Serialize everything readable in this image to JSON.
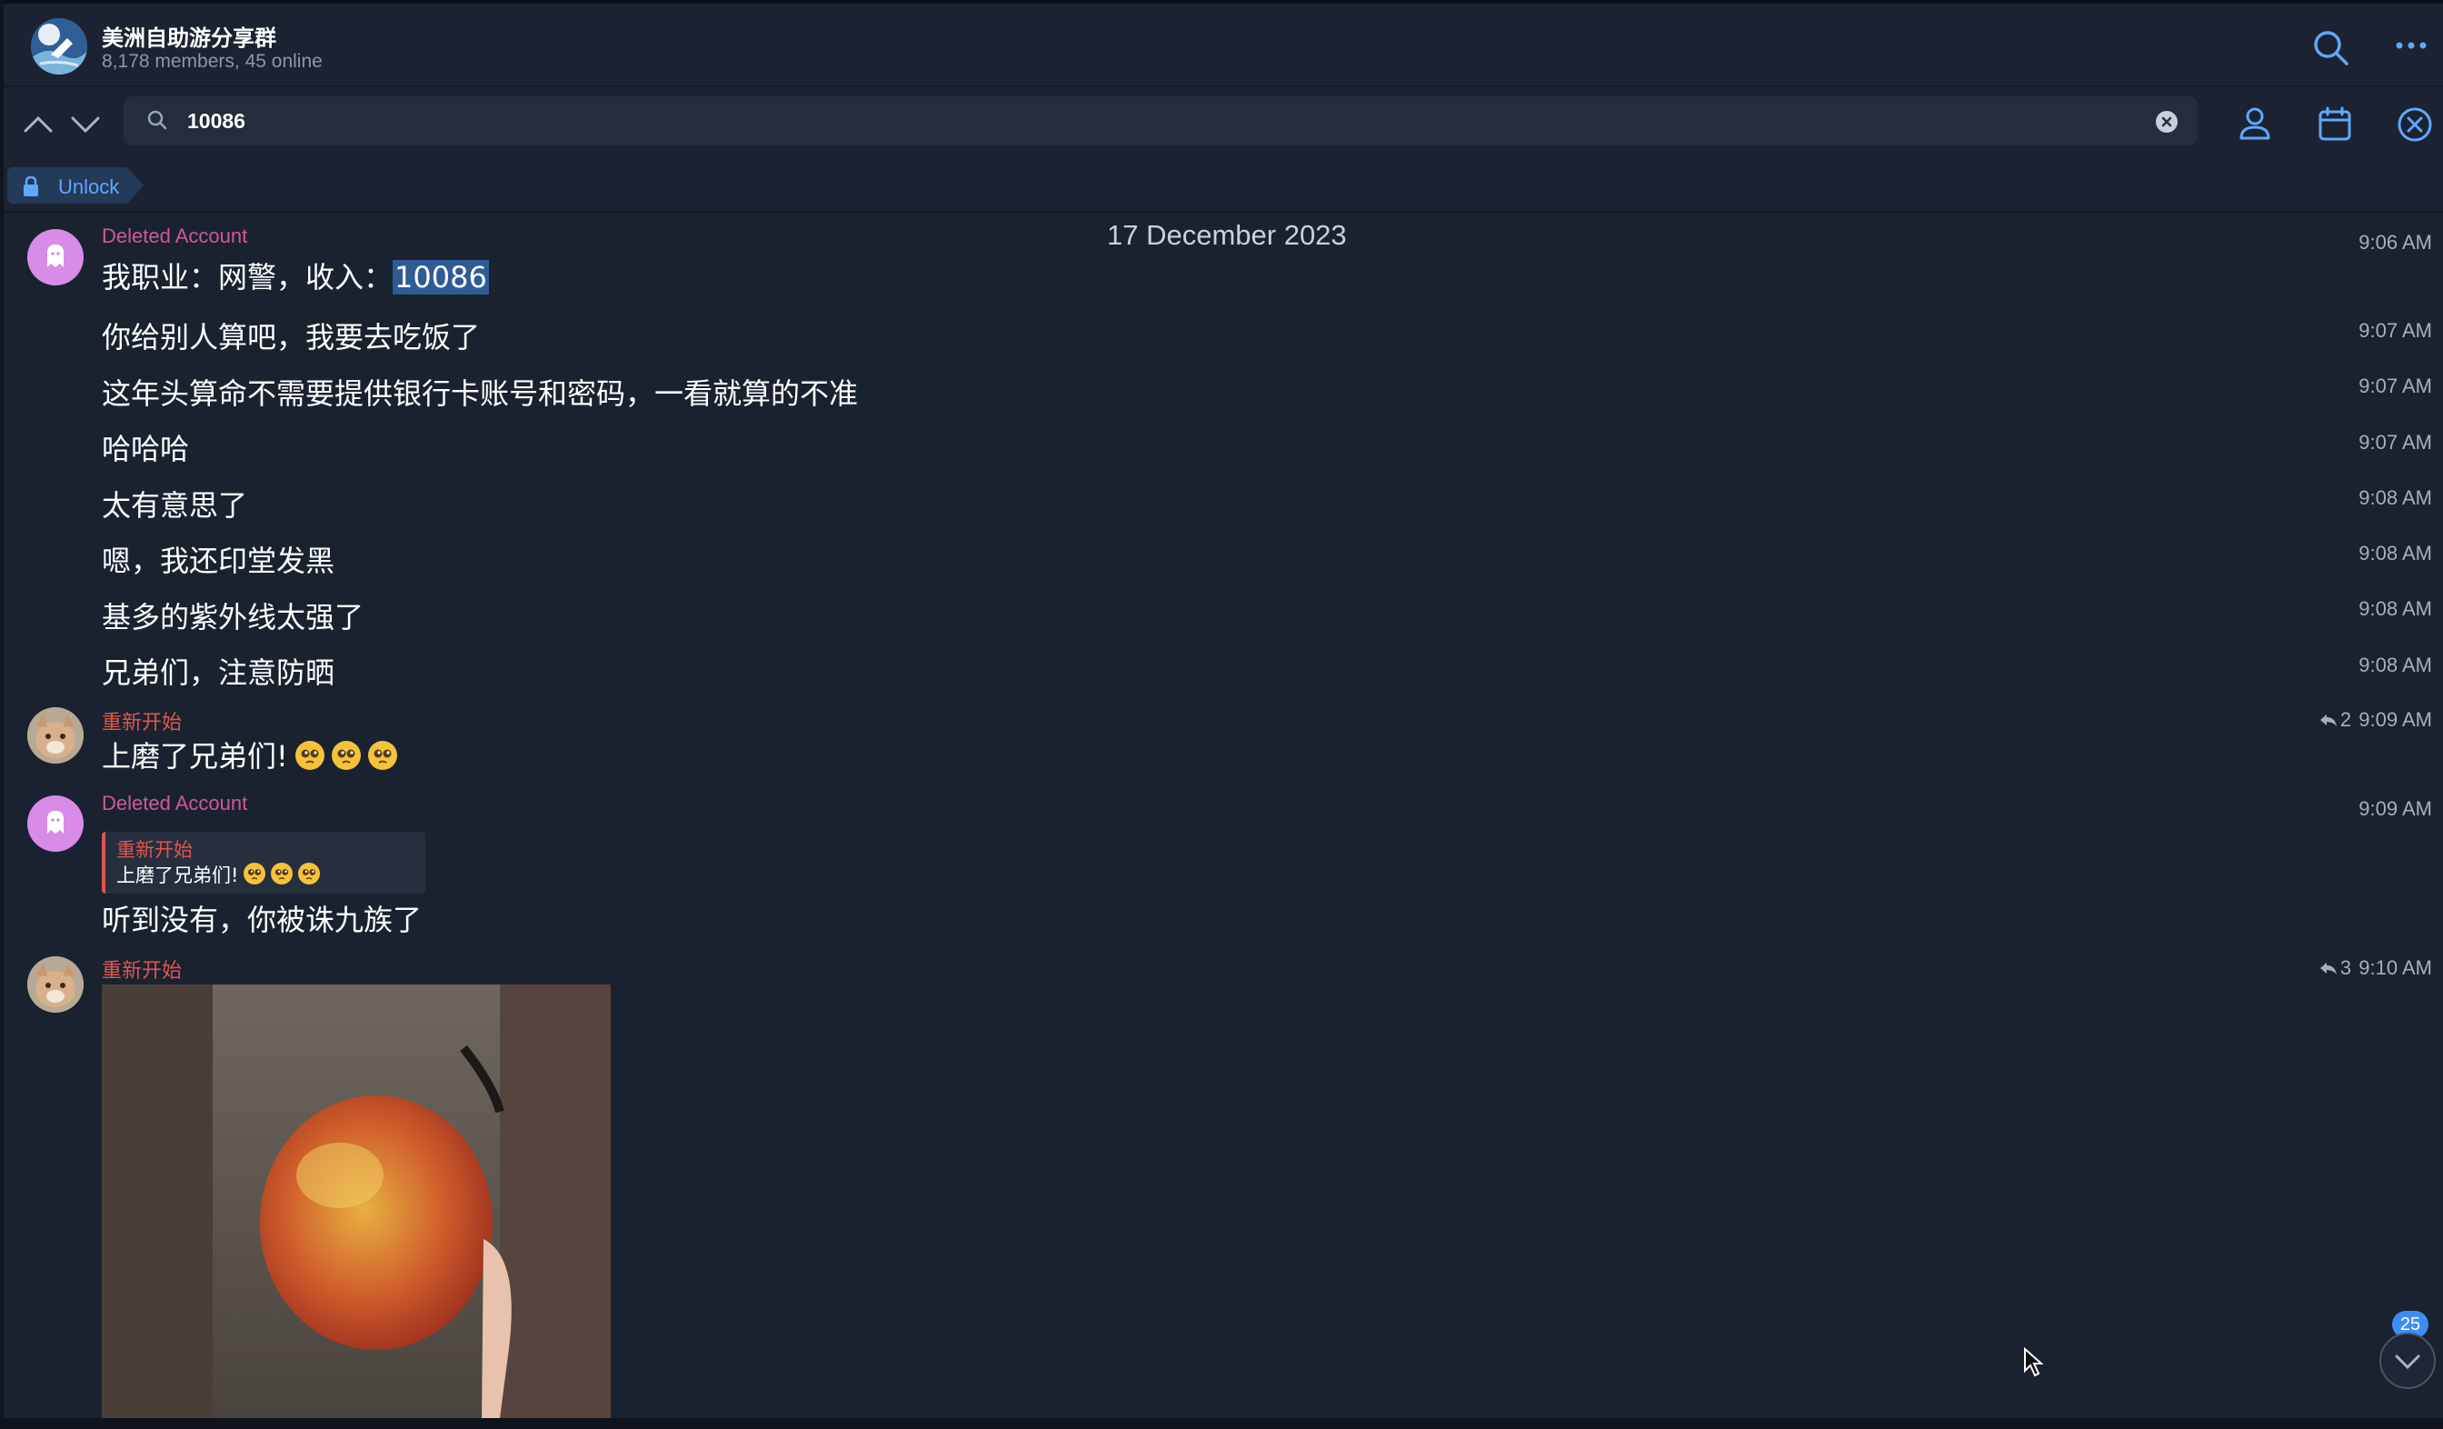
{
  "header": {
    "title": "美洲自助游分享群",
    "subtitle": "8,178 members, 45 online"
  },
  "search": {
    "query": "10086"
  },
  "unlock": {
    "label": "Unlock"
  },
  "messages": {
    "date": "17 December 2023",
    "m0": {
      "sender": "Deleted Account",
      "prefix": "我职业：网警，收入：",
      "highlight": "10086",
      "time": "9:06 AM"
    },
    "m1": {
      "text": "你给别人算吧，我要去吃饭了",
      "time": "9:07 AM"
    },
    "m2": {
      "text": "这年头算命不需要提供银行卡账号和密码，一看就算的不准",
      "time": "9:07 AM"
    },
    "m3": {
      "text": "哈哈哈",
      "time": "9:07 AM"
    },
    "m4": {
      "text": "太有意思了",
      "time": "9:08 AM"
    },
    "m5": {
      "text": "嗯，我还印堂发黑",
      "time": "9:08 AM"
    },
    "m6": {
      "text": "基多的紫外线太强了",
      "time": "9:08 AM"
    },
    "m7": {
      "text": "兄弟们，注意防晒",
      "time": "9:08 AM"
    },
    "m8": {
      "sender": "重新开始",
      "text": "上磨了兄弟们!",
      "replies": "2",
      "time": "9:09 AM"
    },
    "m9": {
      "sender": "Deleted Account",
      "quote_sender": "重新开始",
      "quote_text": "上磨了兄弟们!",
      "text": "听到没有，你被诛九族了",
      "time": "9:09 AM"
    },
    "m10": {
      "sender": "重新开始",
      "replies": "3",
      "time": "9:10 AM"
    }
  },
  "scroll": {
    "unread_count": "25"
  },
  "colors": {
    "background": "#1a2230",
    "accent": "#3d8ef2",
    "deleted_account_name": "#d0589a",
    "restart_name": "#e0564e"
  },
  "icons": [
    "search-icon",
    "more-icon",
    "chevron-up-icon",
    "chevron-down-icon",
    "magnifier-icon",
    "clear-icon",
    "person-icon",
    "calendar-icon",
    "close-icon",
    "lock-icon",
    "reply-arrow-icon",
    "scroll-down-icon"
  ]
}
